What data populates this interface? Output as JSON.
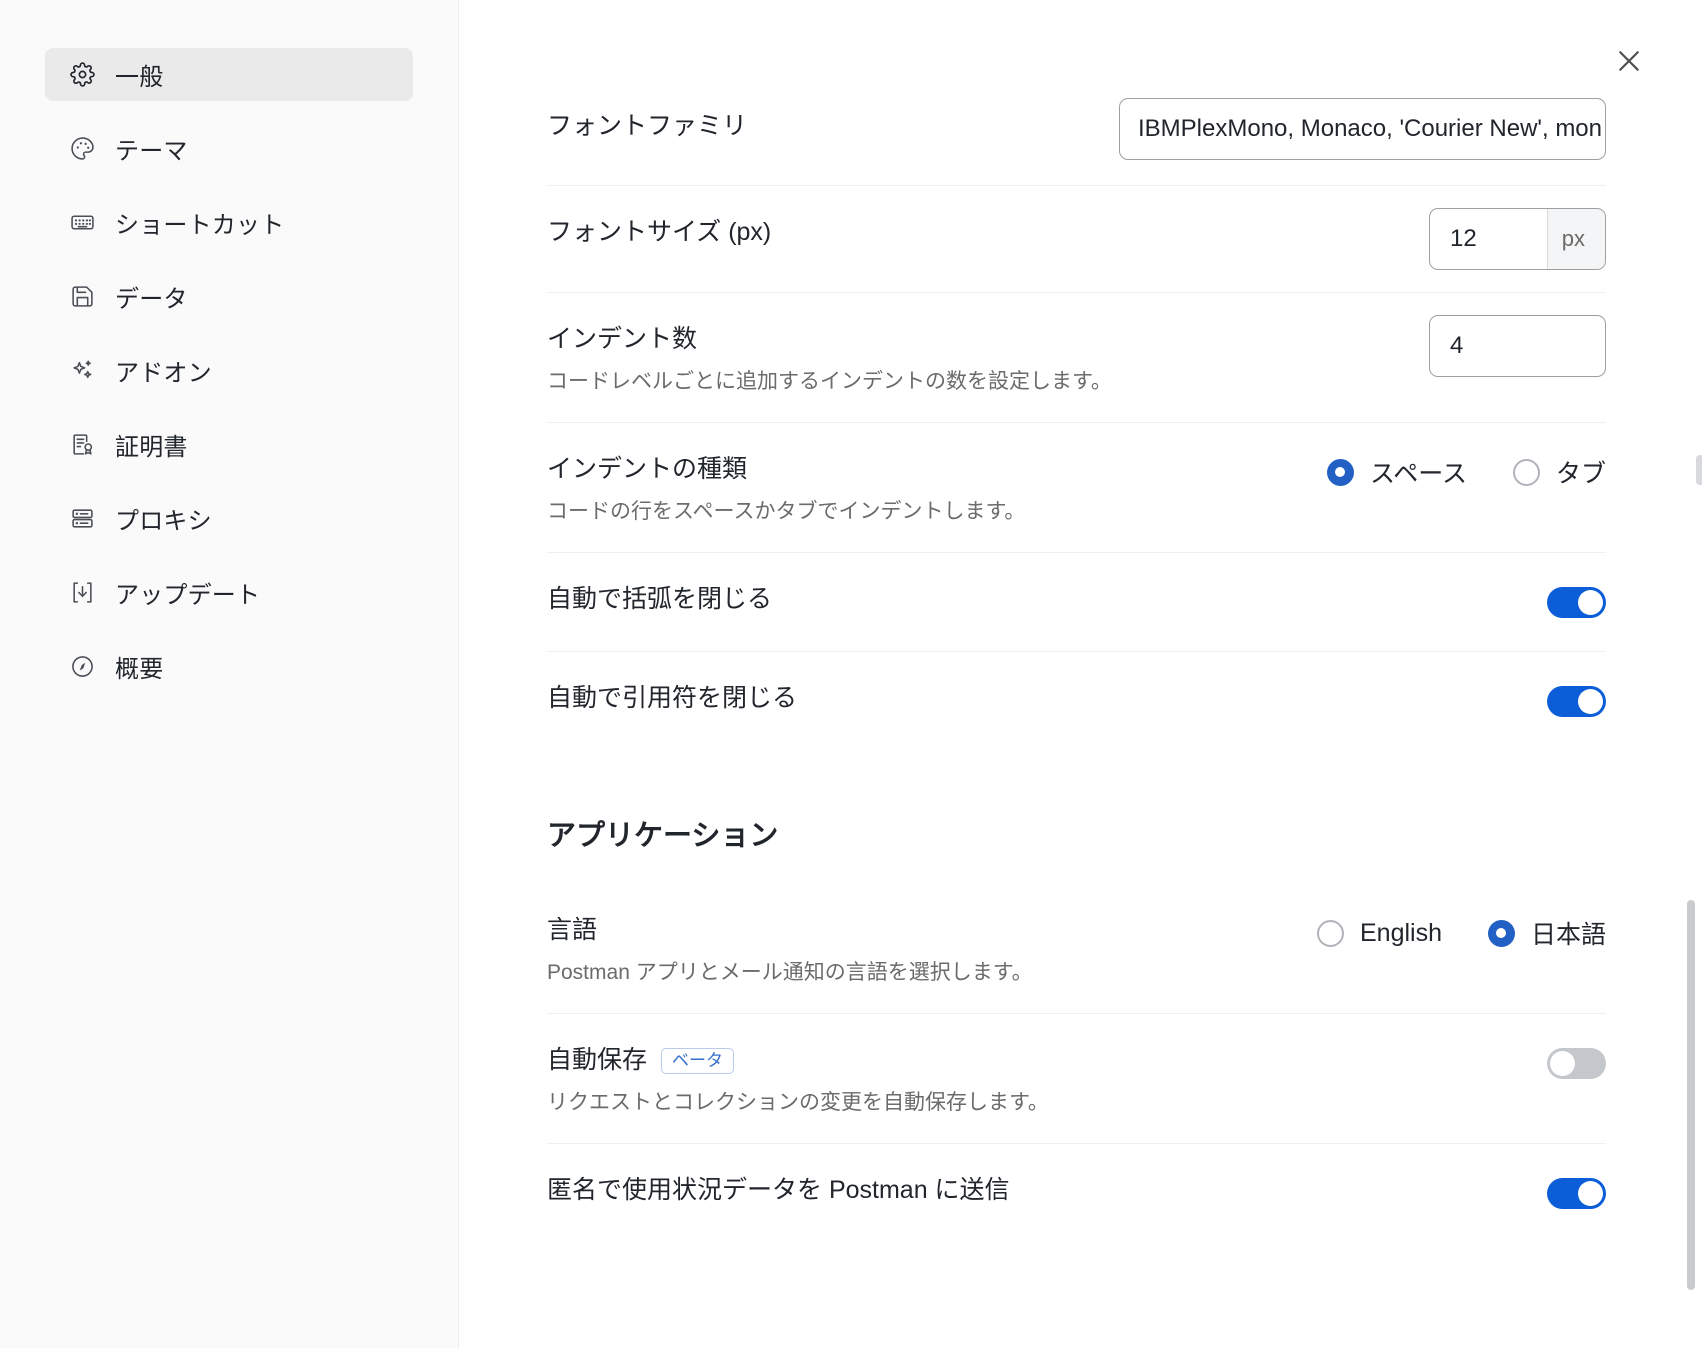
{
  "sidebar": {
    "items": [
      {
        "label": "一般",
        "icon": "gear-icon",
        "active": true
      },
      {
        "label": "テーマ",
        "icon": "palette-icon",
        "active": false
      },
      {
        "label": "ショートカット",
        "icon": "keyboard-icon",
        "active": false
      },
      {
        "label": "データ",
        "icon": "save-disk-icon",
        "active": false
      },
      {
        "label": "アドオン",
        "icon": "sparkle-icon",
        "active": false
      },
      {
        "label": "証明書",
        "icon": "certificate-icon",
        "active": false
      },
      {
        "label": "プロキシ",
        "icon": "server-icon",
        "active": false
      },
      {
        "label": "アップデート",
        "icon": "download-icon",
        "active": false
      },
      {
        "label": "概要",
        "icon": "info-circle-icon",
        "active": false
      }
    ]
  },
  "close_button": {
    "icon": "close-icon",
    "label": "✕"
  },
  "settings": {
    "font_family": {
      "title": "フォントファミリ",
      "value": "IBMPlexMono, Monaco, 'Courier New', mon"
    },
    "font_size": {
      "title": "フォントサイズ (px)",
      "value": "12",
      "suffix": "px"
    },
    "indent_count": {
      "title": "インデント数",
      "description": "コードレベルごとに追加するインデントの数を設定します。",
      "value": "4"
    },
    "indent_type": {
      "title": "インデントの種類",
      "description": "コードの行をスペースかタブでインデントします。",
      "options": [
        {
          "label": "スペース",
          "selected": true
        },
        {
          "label": "タブ",
          "selected": false
        }
      ]
    },
    "auto_close_brackets": {
      "title": "自動で括弧を閉じる",
      "enabled": true
    },
    "auto_close_quotes": {
      "title": "自動で引用符を閉じる",
      "enabled": true
    }
  },
  "application": {
    "heading": "アプリケーション",
    "language": {
      "title": "言語",
      "description": "Postman アプリとメール通知の言語を選択します。",
      "options": [
        {
          "label": "English",
          "selected": false
        },
        {
          "label": "日本語",
          "selected": true
        }
      ]
    },
    "autosave": {
      "title": "自動保存",
      "badge": "ベータ",
      "description": "リクエストとコレクションの変更を自動保存します。",
      "enabled": false
    },
    "telemetry": {
      "title": "匿名で使用状況データを Postman に送信",
      "enabled": true
    }
  },
  "colors": {
    "accent": "#0b5ed7",
    "radio_selected": "#2260c5",
    "sidebar_bg": "#fafafa",
    "active_item_bg": "#eaeaea",
    "badge_text": "#3670cc"
  }
}
